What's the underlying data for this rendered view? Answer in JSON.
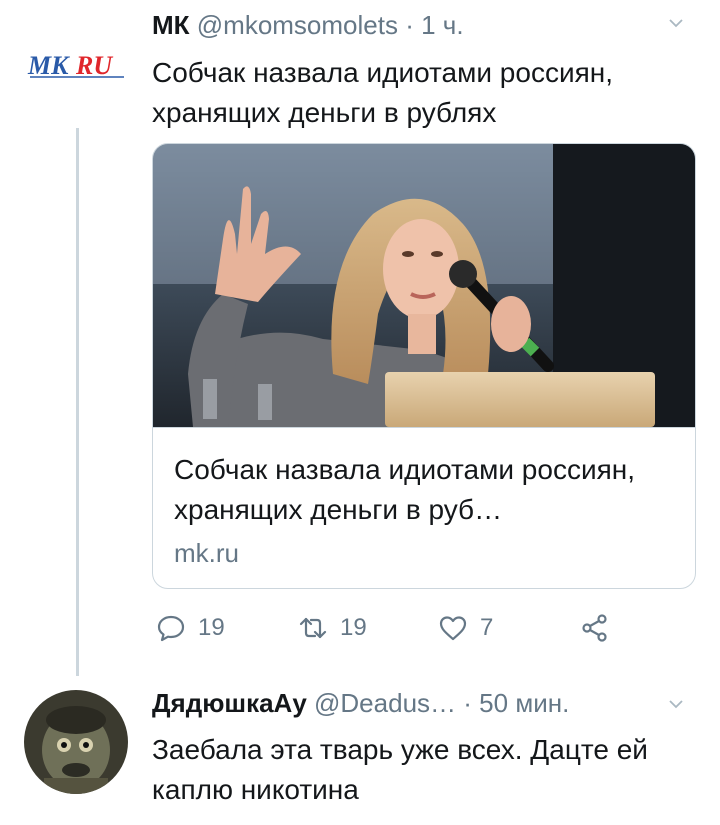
{
  "tweet": {
    "name": "МК",
    "handle": "@mkomsomolets",
    "separator": "·",
    "time": "1 ч.",
    "logo_text": "MKRU",
    "text": "Собчак назвала идиотами россиян, хранящих деньги в рублях",
    "card": {
      "title": "Собчак назвала идиотами россиян, хранящих деньги в руб…",
      "domain": "mk.ru"
    },
    "actions": {
      "reply_count": "19",
      "retweet_count": "19",
      "like_count": "7"
    }
  },
  "reply": {
    "name": "ДядюшкаАу",
    "handle": "@Deadus…",
    "separator": "·",
    "time": "50 мин.",
    "text": "Заебала эта тварь уже всех. Дацте ей каплю никотина"
  },
  "colors": {
    "text": "#14171a",
    "secondary": "#657786",
    "border": "#ccd6dd",
    "logo_blue": "#2a5aa8",
    "logo_red": "#e0262b"
  }
}
